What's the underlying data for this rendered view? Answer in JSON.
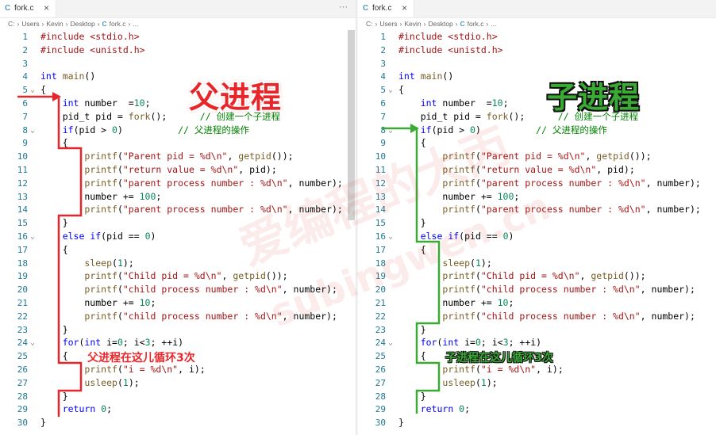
{
  "left": {
    "tab": {
      "icon": "C",
      "name": "fork.c",
      "close": "×"
    },
    "more": "···",
    "breadcrumb": {
      "path": [
        "C:",
        "Users",
        "Kevin",
        "Desktop"
      ],
      "file_icon": "C",
      "file": "fork.c",
      "tail": "..."
    },
    "big_label": "父进程",
    "small_label": "父进程在这儿循环3次",
    "accent": "#e8262a"
  },
  "right": {
    "tab": {
      "icon": "C",
      "name": "fork.c",
      "close": "×"
    },
    "breadcrumb": {
      "path": [
        "C:",
        "Users",
        "Kevin",
        "Desktop"
      ],
      "file_icon": "C",
      "file": "fork.c",
      "tail": "..."
    },
    "big_label": "子进程",
    "small_label": "子进程在这儿循环3次",
    "accent": "#3aaa35"
  },
  "watermark": {
    "line1": "爱编程的大丙",
    "line2": "subingwen.cn"
  },
  "code_lines": [
    {
      "n": "1",
      "fold": "",
      "t": [
        [
          "pp",
          "#include <stdio.h>"
        ]
      ]
    },
    {
      "n": "2",
      "fold": "",
      "t": [
        [
          "pp",
          "#include <unistd.h>"
        ]
      ]
    },
    {
      "n": "3",
      "fold": "",
      "t": []
    },
    {
      "n": "4",
      "fold": "",
      "t": [
        [
          "kw",
          "int "
        ],
        [
          "tk",
          "main"
        ],
        [
          "",
          "()"
        ]
      ]
    },
    {
      "n": "5",
      "fold": "⌄",
      "t": [
        [
          "",
          "{"
        ]
      ]
    },
    {
      "n": "6",
      "fold": "",
      "t": [
        [
          "",
          "    "
        ],
        [
          "kw",
          "int "
        ],
        [
          "",
          "number  ="
        ],
        [
          "num",
          "10"
        ],
        [
          "",
          ";"
        ]
      ]
    },
    {
      "n": "7",
      "fold": "",
      "t": [
        [
          "",
          "    pid_t pid = "
        ],
        [
          "tk",
          "fork"
        ],
        [
          "",
          "();      "
        ],
        [
          "cm",
          "// 创建一个子进程"
        ]
      ]
    },
    {
      "n": "8",
      "fold": "⌄",
      "t": [
        [
          "",
          "    "
        ],
        [
          "kw",
          "if"
        ],
        [
          "",
          "(pid > "
        ],
        [
          "num",
          "0"
        ],
        [
          "",
          ")          "
        ],
        [
          "cm",
          "// 父进程的操作"
        ]
      ]
    },
    {
      "n": "9",
      "fold": "",
      "t": [
        [
          "",
          "    {"
        ]
      ]
    },
    {
      "n": "10",
      "fold": "",
      "t": [
        [
          "",
          "        "
        ],
        [
          "tk",
          "printf"
        ],
        [
          "",
          "("
        ],
        [
          "str",
          "\"Parent pid = %d\\n\""
        ],
        [
          "",
          ", "
        ],
        [
          "tk",
          "getpid"
        ],
        [
          "",
          "());"
        ]
      ]
    },
    {
      "n": "11",
      "fold": "",
      "t": [
        [
          "",
          "        "
        ],
        [
          "tk",
          "printf"
        ],
        [
          "",
          "("
        ],
        [
          "str",
          "\"return value = %d\\n\""
        ],
        [
          "",
          ", pid);"
        ]
      ]
    },
    {
      "n": "12",
      "fold": "",
      "t": [
        [
          "",
          "        "
        ],
        [
          "tk",
          "printf"
        ],
        [
          "",
          "("
        ],
        [
          "str",
          "\"parent process number : %d\\n\""
        ],
        [
          "",
          ", number);"
        ]
      ]
    },
    {
      "n": "13",
      "fold": "",
      "t": [
        [
          "",
          "        number += "
        ],
        [
          "num",
          "100"
        ],
        [
          "",
          ";"
        ]
      ]
    },
    {
      "n": "14",
      "fold": "",
      "t": [
        [
          "",
          "        "
        ],
        [
          "tk",
          "printf"
        ],
        [
          "",
          "("
        ],
        [
          "str",
          "\"parent process number : %d\\n\""
        ],
        [
          "",
          ", number);"
        ]
      ]
    },
    {
      "n": "15",
      "fold": "",
      "t": [
        [
          "",
          "    }"
        ]
      ]
    },
    {
      "n": "16",
      "fold": "⌄",
      "t": [
        [
          "",
          "    "
        ],
        [
          "kw",
          "else if"
        ],
        [
          "",
          "(pid == "
        ],
        [
          "num",
          "0"
        ],
        [
          "",
          ")"
        ]
      ]
    },
    {
      "n": "17",
      "fold": "",
      "t": [
        [
          "",
          "    {"
        ]
      ]
    },
    {
      "n": "18",
      "fold": "",
      "t": [
        [
          "",
          "        "
        ],
        [
          "tk",
          "sleep"
        ],
        [
          "",
          "("
        ],
        [
          "num",
          "1"
        ],
        [
          "",
          ");"
        ]
      ]
    },
    {
      "n": "19",
      "fold": "",
      "t": [
        [
          "",
          "        "
        ],
        [
          "tk",
          "printf"
        ],
        [
          "",
          "("
        ],
        [
          "str",
          "\"Child pid = %d\\n\""
        ],
        [
          "",
          ", "
        ],
        [
          "tk",
          "getpid"
        ],
        [
          "",
          "());"
        ]
      ]
    },
    {
      "n": "20",
      "fold": "",
      "t": [
        [
          "",
          "        "
        ],
        [
          "tk",
          "printf"
        ],
        [
          "",
          "("
        ],
        [
          "str",
          "\"child process number : %d\\n\""
        ],
        [
          "",
          ", number);"
        ]
      ]
    },
    {
      "n": "21",
      "fold": "",
      "t": [
        [
          "",
          "        number += "
        ],
        [
          "num",
          "10"
        ],
        [
          "",
          ";"
        ]
      ]
    },
    {
      "n": "22",
      "fold": "",
      "t": [
        [
          "",
          "        "
        ],
        [
          "tk",
          "printf"
        ],
        [
          "",
          "("
        ],
        [
          "str",
          "\"child process number : %d\\n\""
        ],
        [
          "",
          ", number);"
        ]
      ]
    },
    {
      "n": "23",
      "fold": "",
      "t": [
        [
          "",
          "    }"
        ]
      ]
    },
    {
      "n": "24",
      "fold": "⌄",
      "t": [
        [
          "",
          "    "
        ],
        [
          "kw",
          "for"
        ],
        [
          "",
          "("
        ],
        [
          "kw",
          "int "
        ],
        [
          "",
          "i="
        ],
        [
          "num",
          "0"
        ],
        [
          "",
          "; i<"
        ],
        [
          "num",
          "3"
        ],
        [
          "",
          "; ++i)"
        ]
      ]
    },
    {
      "n": "25",
      "fold": "",
      "t": [
        [
          "",
          "    {"
        ]
      ]
    },
    {
      "n": "26",
      "fold": "",
      "t": [
        [
          "",
          "        "
        ],
        [
          "tk",
          "printf"
        ],
        [
          "",
          "("
        ],
        [
          "str",
          "\"i = %d\\n\""
        ],
        [
          "",
          ", i);"
        ]
      ]
    },
    {
      "n": "27",
      "fold": "",
      "t": [
        [
          "",
          "        "
        ],
        [
          "tk",
          "usleep"
        ],
        [
          "",
          "("
        ],
        [
          "num",
          "1"
        ],
        [
          "",
          ");"
        ]
      ]
    },
    {
      "n": "28",
      "fold": "",
      "t": [
        [
          "",
          "    }"
        ]
      ]
    },
    {
      "n": "29",
      "fold": "",
      "t": [
        [
          "",
          "    "
        ],
        [
          "kw",
          "return "
        ],
        [
          "num",
          "0"
        ],
        [
          "",
          ";"
        ]
      ]
    },
    {
      "n": "30",
      "fold": "",
      "t": [
        [
          "",
          "}"
        ]
      ]
    }
  ]
}
